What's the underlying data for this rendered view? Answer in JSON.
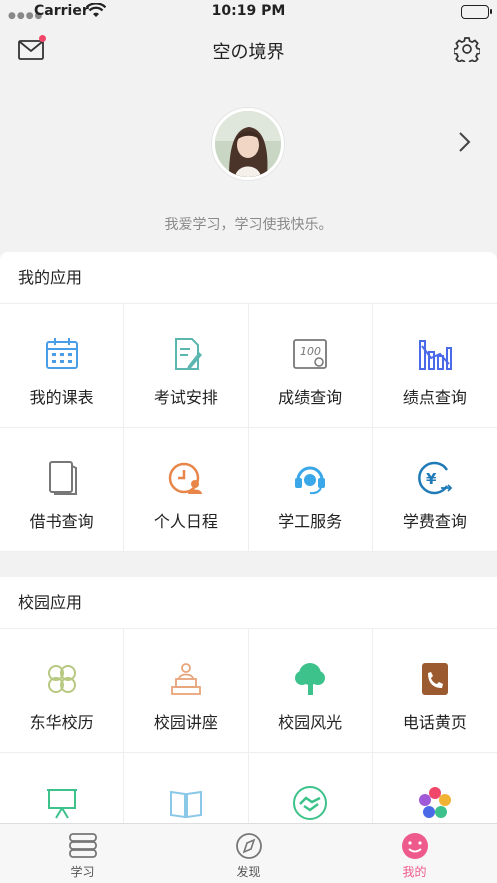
{
  "status_bar": {
    "carrier": "Carrier",
    "time": "10:19 PM",
    "battery_level": 1.0
  },
  "navbar": {
    "title": "空の境界"
  },
  "profile": {
    "motto": "我爱学习，学习使我快乐。"
  },
  "my_apps": {
    "header": "我的应用",
    "items": [
      {
        "label": "我的课表",
        "icon": "calendar-icon"
      },
      {
        "label": "考试安排",
        "icon": "exam-edit-icon"
      },
      {
        "label": "成绩查询",
        "icon": "score-100-icon"
      },
      {
        "label": "绩点查询",
        "icon": "gpa-chart-icon"
      },
      {
        "label": "借书查询",
        "icon": "book-icon"
      },
      {
        "label": "个人日程",
        "icon": "schedule-clock-icon"
      },
      {
        "label": "学工服务",
        "icon": "headset-icon"
      },
      {
        "label": "学费查询",
        "icon": "yuan-coin-icon"
      }
    ]
  },
  "campus_apps": {
    "header": "校园应用",
    "items": [
      {
        "label": "东华校历",
        "icon": "clover-icon"
      },
      {
        "label": "校园讲座",
        "icon": "lecture-podium-icon"
      },
      {
        "label": "校园风光",
        "icon": "tree-icon"
      },
      {
        "label": "电话黄页",
        "icon": "phone-book-icon"
      },
      {
        "label": "",
        "icon": "presentation-board-icon"
      },
      {
        "label": "",
        "icon": "open-book-icon"
      },
      {
        "label": "",
        "icon": "handshake-icon"
      },
      {
        "label": "",
        "icon": "colorful-flower-icon"
      }
    ]
  },
  "tabbar": {
    "tabs": [
      {
        "label": "学习",
        "icon": "books-icon",
        "active": false
      },
      {
        "label": "发现",
        "icon": "compass-icon",
        "active": false
      },
      {
        "label": "我的",
        "icon": "smiley-icon",
        "active": true
      }
    ]
  },
  "colors": {
    "accent": "#ef5a8d",
    "badge": "#f0466a",
    "icon_blue": "#4a9ee8",
    "icon_orange": "#e8864a",
    "icon_green": "#3cc28a"
  }
}
